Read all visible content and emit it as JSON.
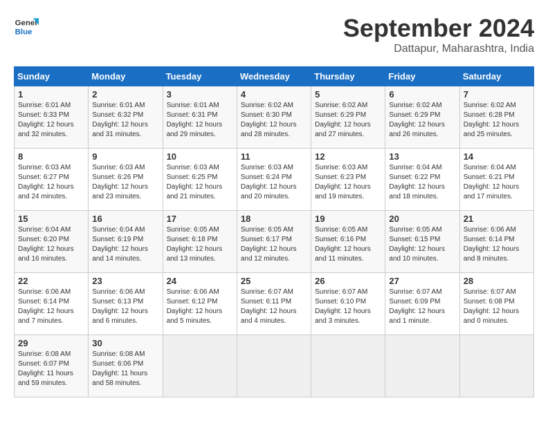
{
  "header": {
    "logo_text_line1": "General",
    "logo_text_line2": "Blue",
    "month_title": "September 2024",
    "location": "Dattapur, Maharashtra, India"
  },
  "weekdays": [
    "Sunday",
    "Monday",
    "Tuesday",
    "Wednesday",
    "Thursday",
    "Friday",
    "Saturday"
  ],
  "weeks": [
    [
      {
        "day": "1",
        "sunrise": "Sunrise: 6:01 AM",
        "sunset": "Sunset: 6:33 PM",
        "daylight": "Daylight: 12 hours and 32 minutes."
      },
      {
        "day": "2",
        "sunrise": "Sunrise: 6:01 AM",
        "sunset": "Sunset: 6:32 PM",
        "daylight": "Daylight: 12 hours and 31 minutes."
      },
      {
        "day": "3",
        "sunrise": "Sunrise: 6:01 AM",
        "sunset": "Sunset: 6:31 PM",
        "daylight": "Daylight: 12 hours and 29 minutes."
      },
      {
        "day": "4",
        "sunrise": "Sunrise: 6:02 AM",
        "sunset": "Sunset: 6:30 PM",
        "daylight": "Daylight: 12 hours and 28 minutes."
      },
      {
        "day": "5",
        "sunrise": "Sunrise: 6:02 AM",
        "sunset": "Sunset: 6:29 PM",
        "daylight": "Daylight: 12 hours and 27 minutes."
      },
      {
        "day": "6",
        "sunrise": "Sunrise: 6:02 AM",
        "sunset": "Sunset: 6:29 PM",
        "daylight": "Daylight: 12 hours and 26 minutes."
      },
      {
        "day": "7",
        "sunrise": "Sunrise: 6:02 AM",
        "sunset": "Sunset: 6:28 PM",
        "daylight": "Daylight: 12 hours and 25 minutes."
      }
    ],
    [
      {
        "day": "8",
        "sunrise": "Sunrise: 6:03 AM",
        "sunset": "Sunset: 6:27 PM",
        "daylight": "Daylight: 12 hours and 24 minutes."
      },
      {
        "day": "9",
        "sunrise": "Sunrise: 6:03 AM",
        "sunset": "Sunset: 6:26 PM",
        "daylight": "Daylight: 12 hours and 23 minutes."
      },
      {
        "day": "10",
        "sunrise": "Sunrise: 6:03 AM",
        "sunset": "Sunset: 6:25 PM",
        "daylight": "Daylight: 12 hours and 21 minutes."
      },
      {
        "day": "11",
        "sunrise": "Sunrise: 6:03 AM",
        "sunset": "Sunset: 6:24 PM",
        "daylight": "Daylight: 12 hours and 20 minutes."
      },
      {
        "day": "12",
        "sunrise": "Sunrise: 6:03 AM",
        "sunset": "Sunset: 6:23 PM",
        "daylight": "Daylight: 12 hours and 19 minutes."
      },
      {
        "day": "13",
        "sunrise": "Sunrise: 6:04 AM",
        "sunset": "Sunset: 6:22 PM",
        "daylight": "Daylight: 12 hours and 18 minutes."
      },
      {
        "day": "14",
        "sunrise": "Sunrise: 6:04 AM",
        "sunset": "Sunset: 6:21 PM",
        "daylight": "Daylight: 12 hours and 17 minutes."
      }
    ],
    [
      {
        "day": "15",
        "sunrise": "Sunrise: 6:04 AM",
        "sunset": "Sunset: 6:20 PM",
        "daylight": "Daylight: 12 hours and 16 minutes."
      },
      {
        "day": "16",
        "sunrise": "Sunrise: 6:04 AM",
        "sunset": "Sunset: 6:19 PM",
        "daylight": "Daylight: 12 hours and 14 minutes."
      },
      {
        "day": "17",
        "sunrise": "Sunrise: 6:05 AM",
        "sunset": "Sunset: 6:18 PM",
        "daylight": "Daylight: 12 hours and 13 minutes."
      },
      {
        "day": "18",
        "sunrise": "Sunrise: 6:05 AM",
        "sunset": "Sunset: 6:17 PM",
        "daylight": "Daylight: 12 hours and 12 minutes."
      },
      {
        "day": "19",
        "sunrise": "Sunrise: 6:05 AM",
        "sunset": "Sunset: 6:16 PM",
        "daylight": "Daylight: 12 hours and 11 minutes."
      },
      {
        "day": "20",
        "sunrise": "Sunrise: 6:05 AM",
        "sunset": "Sunset: 6:15 PM",
        "daylight": "Daylight: 12 hours and 10 minutes."
      },
      {
        "day": "21",
        "sunrise": "Sunrise: 6:06 AM",
        "sunset": "Sunset: 6:14 PM",
        "daylight": "Daylight: 12 hours and 8 minutes."
      }
    ],
    [
      {
        "day": "22",
        "sunrise": "Sunrise: 6:06 AM",
        "sunset": "Sunset: 6:14 PM",
        "daylight": "Daylight: 12 hours and 7 minutes."
      },
      {
        "day": "23",
        "sunrise": "Sunrise: 6:06 AM",
        "sunset": "Sunset: 6:13 PM",
        "daylight": "Daylight: 12 hours and 6 minutes."
      },
      {
        "day": "24",
        "sunrise": "Sunrise: 6:06 AM",
        "sunset": "Sunset: 6:12 PM",
        "daylight": "Daylight: 12 hours and 5 minutes."
      },
      {
        "day": "25",
        "sunrise": "Sunrise: 6:07 AM",
        "sunset": "Sunset: 6:11 PM",
        "daylight": "Daylight: 12 hours and 4 minutes."
      },
      {
        "day": "26",
        "sunrise": "Sunrise: 6:07 AM",
        "sunset": "Sunset: 6:10 PM",
        "daylight": "Daylight: 12 hours and 3 minutes."
      },
      {
        "day": "27",
        "sunrise": "Sunrise: 6:07 AM",
        "sunset": "Sunset: 6:09 PM",
        "daylight": "Daylight: 12 hours and 1 minute."
      },
      {
        "day": "28",
        "sunrise": "Sunrise: 6:07 AM",
        "sunset": "Sunset: 6:08 PM",
        "daylight": "Daylight: 12 hours and 0 minutes."
      }
    ],
    [
      {
        "day": "29",
        "sunrise": "Sunrise: 6:08 AM",
        "sunset": "Sunset: 6:07 PM",
        "daylight": "Daylight: 11 hours and 59 minutes."
      },
      {
        "day": "30",
        "sunrise": "Sunrise: 6:08 AM",
        "sunset": "Sunset: 6:06 PM",
        "daylight": "Daylight: 11 hours and 58 minutes."
      },
      null,
      null,
      null,
      null,
      null
    ]
  ]
}
